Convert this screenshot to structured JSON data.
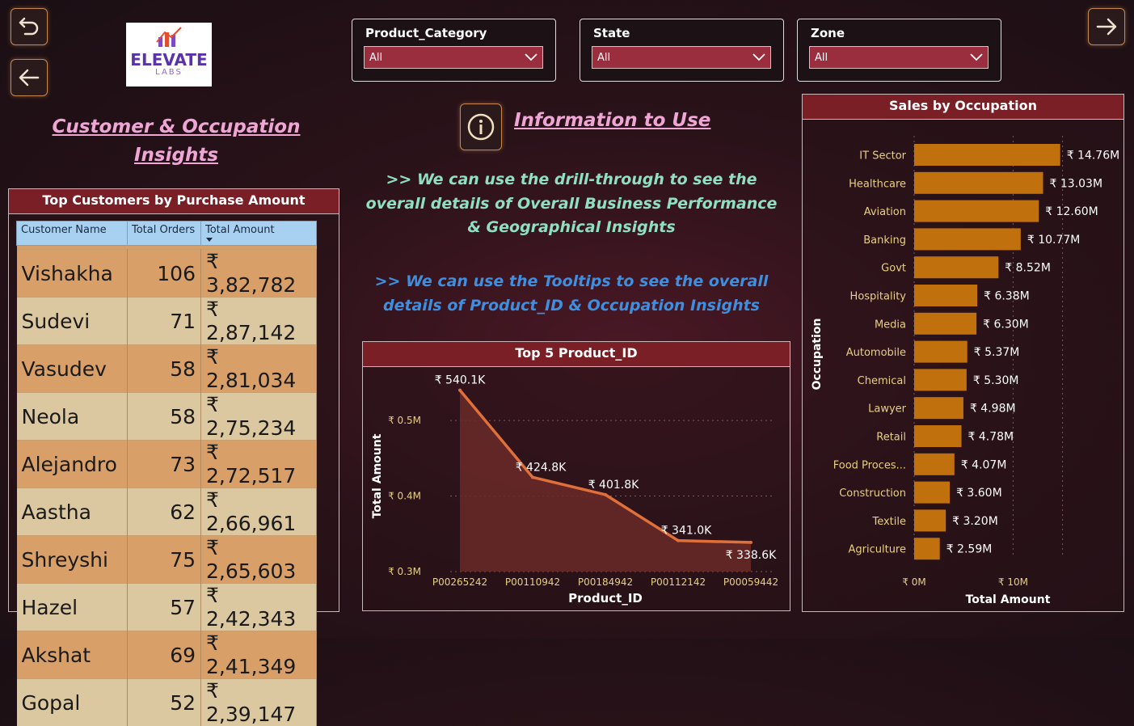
{
  "nav": {
    "undo_icon": "undo-icon",
    "back_icon": "arrow-left-icon",
    "forward_icon": "arrow-right-icon"
  },
  "logo": {
    "line1": "ELEVATE",
    "line2": "LABS"
  },
  "page_title": "Customer & Occupation Insights",
  "filters": [
    {
      "label": "Product_Category",
      "value": "All"
    },
    {
      "label": "State",
      "value": "All"
    },
    {
      "label": "Zone",
      "value": "All"
    }
  ],
  "info": {
    "title": "Information to Use",
    "drill_text": ">> We can use the drill-through to see the overall details of Overall Business Performance & Geographical Insights",
    "tooltip_text": ">> We can use the Tooltips to see the overall details of Product_ID & Occupation Insights"
  },
  "top_customers": {
    "title": "Top Customers by Purchase Amount",
    "columns": [
      "Customer Name",
      "Total Orders",
      "Total Amount"
    ],
    "rows": [
      [
        "Vishakha",
        "106",
        "₹ 3,82,782"
      ],
      [
        "Sudevi",
        "71",
        "₹ 2,87,142"
      ],
      [
        "Vasudev",
        "58",
        "₹ 2,81,034"
      ],
      [
        "Neola",
        "58",
        "₹ 2,75,234"
      ],
      [
        "Alejandro",
        "73",
        "₹ 2,72,517"
      ],
      [
        "Aastha",
        "62",
        "₹ 2,66,961"
      ],
      [
        "Shreyshi",
        "75",
        "₹ 2,65,603"
      ],
      [
        "Hazel",
        "57",
        "₹ 2,42,343"
      ],
      [
        "Akshat",
        "69",
        "₹ 2,41,349"
      ],
      [
        "Gopal",
        "52",
        "₹ 2,39,147"
      ]
    ]
  },
  "colors": {
    "accent": "#7a1f26",
    "bar": "#c0700c",
    "line": "#e0703a",
    "area": "#6a2a28",
    "axis_text": "#e8d080"
  },
  "chart_data": [
    {
      "type": "area",
      "title": "Top 5 Product_ID",
      "xlabel": "Product_ID",
      "ylabel": "Total Amount",
      "categories": [
        "P00265242",
        "P00110942",
        "P00184942",
        "P00112142",
        "P00059442"
      ],
      "values": [
        540.1,
        424.8,
        401.8,
        341.0,
        338.6
      ],
      "value_labels": [
        "₹ 540.1K",
        "₹ 424.8K",
        "₹ 401.8K",
        "₹ 341.0K",
        "₹ 338.6K"
      ],
      "y_ticks": [
        "₹ 0.3M",
        "₹ 0.4M",
        "₹ 0.5M"
      ],
      "y_tick_values": [
        300,
        400,
        500
      ],
      "ylim": [
        300,
        560
      ],
      "grid": true
    },
    {
      "type": "bar",
      "orientation": "horizontal",
      "title": "Sales by Occupation",
      "xlabel": "Total Amount",
      "ylabel": "Occupation",
      "categories": [
        "IT Sector",
        "Healthcare",
        "Aviation",
        "Banking",
        "Govt",
        "Hospitality",
        "Media",
        "Automobile",
        "Chemical",
        "Lawyer",
        "Retail",
        "Food Proces...",
        "Construction",
        "Textile",
        "Agriculture"
      ],
      "values": [
        14.76,
        13.03,
        12.6,
        10.77,
        8.52,
        6.38,
        6.3,
        5.37,
        5.3,
        4.98,
        4.78,
        4.07,
        3.6,
        3.2,
        2.59
      ],
      "value_labels": [
        "₹ 14.76M",
        "₹ 13.03M",
        "₹ 12.60M",
        "₹ 10.77M",
        "₹ 8.52M",
        "₹ 6.38M",
        "₹ 6.30M",
        "₹ 5.37M",
        "₹ 5.30M",
        "₹ 4.98M",
        "₹ 4.78M",
        "₹ 4.07M",
        "₹ 3.60M",
        "₹ 3.20M",
        "₹ 2.59M"
      ],
      "x_ticks": [
        "₹ 0M",
        "₹ 10M"
      ],
      "x_tick_values": [
        0,
        10
      ],
      "xlim": [
        0,
        16.5
      ],
      "grid": true
    }
  ]
}
